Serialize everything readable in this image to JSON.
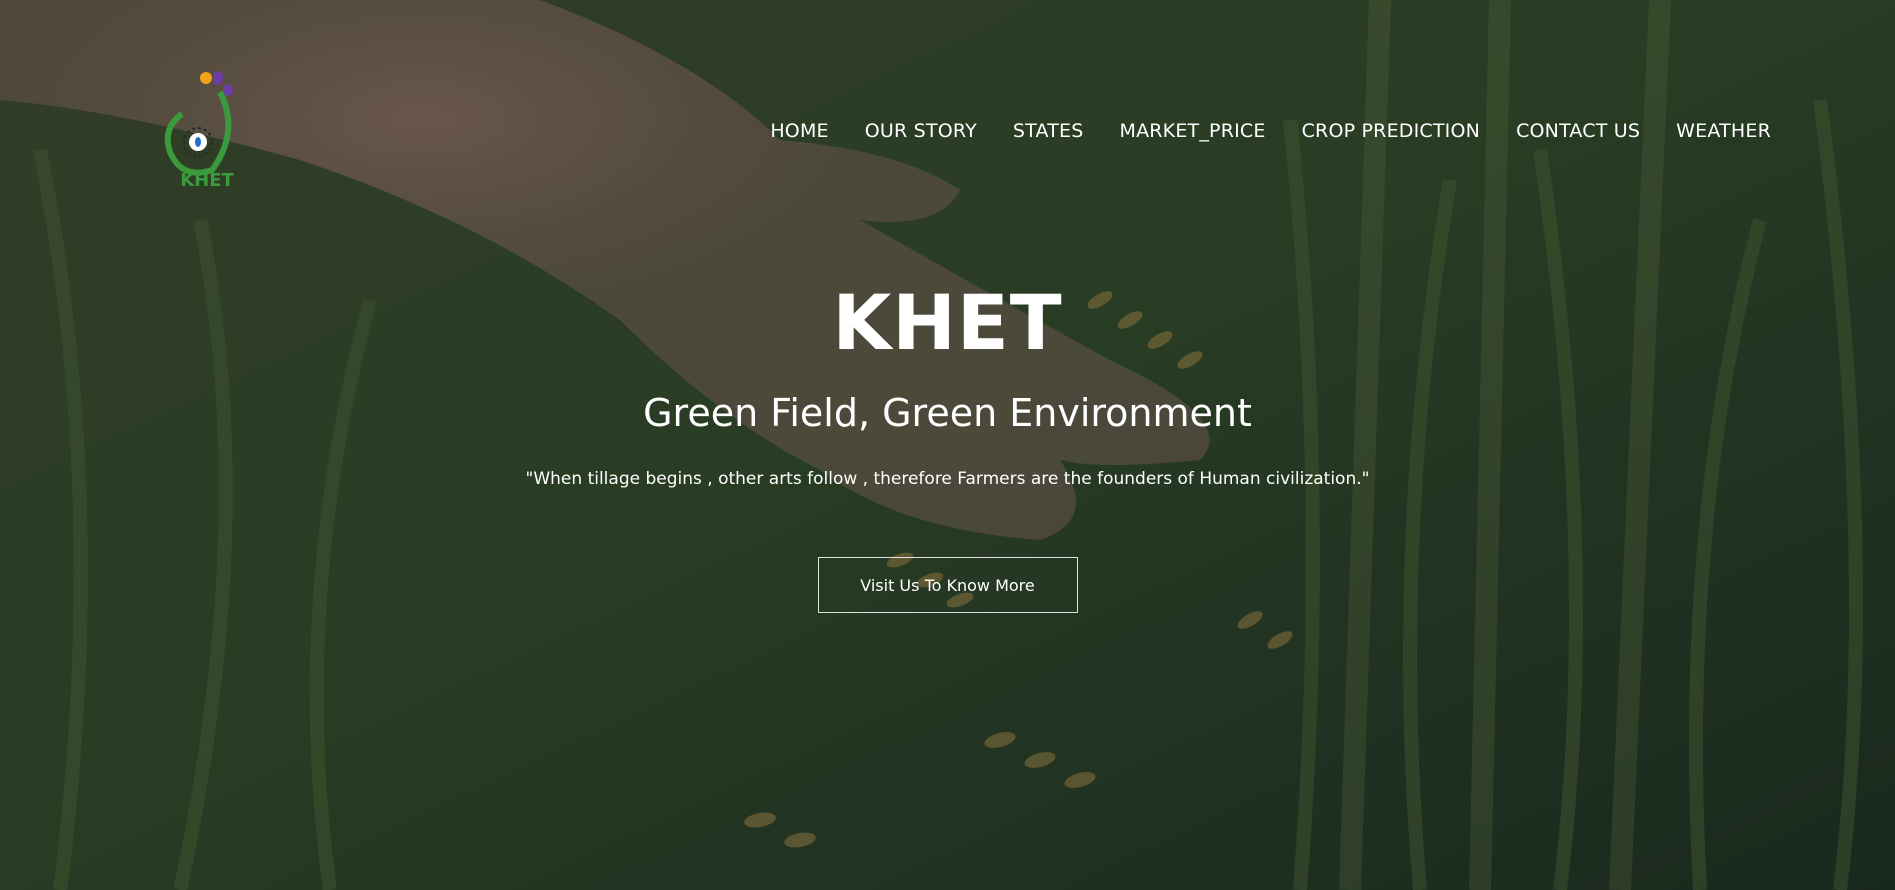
{
  "brand": {
    "logo_icon": "khet-leaf-logo",
    "colors": {
      "green": "#3a9a3c",
      "orange": "#f0a21a",
      "purple": "#6b3fa6",
      "navy": "#1f2a6b"
    }
  },
  "nav": {
    "items": [
      {
        "label": "HOME"
      },
      {
        "label": "OUR STORY"
      },
      {
        "label": "STATES"
      },
      {
        "label": "MARKET_PRICE"
      },
      {
        "label": "CROP PREDICTION"
      },
      {
        "label": "CONTACT US"
      },
      {
        "label": "WEATHER"
      }
    ]
  },
  "hero": {
    "title": "KHET",
    "subtitle": "Green Field, Green Environment",
    "quote": "\"When tillage begins , other arts follow , therefore Farmers are the founders of Human civilization.\"",
    "cta_label": "Visit Us To Know More",
    "background": "wheat-field-hand-photo"
  }
}
